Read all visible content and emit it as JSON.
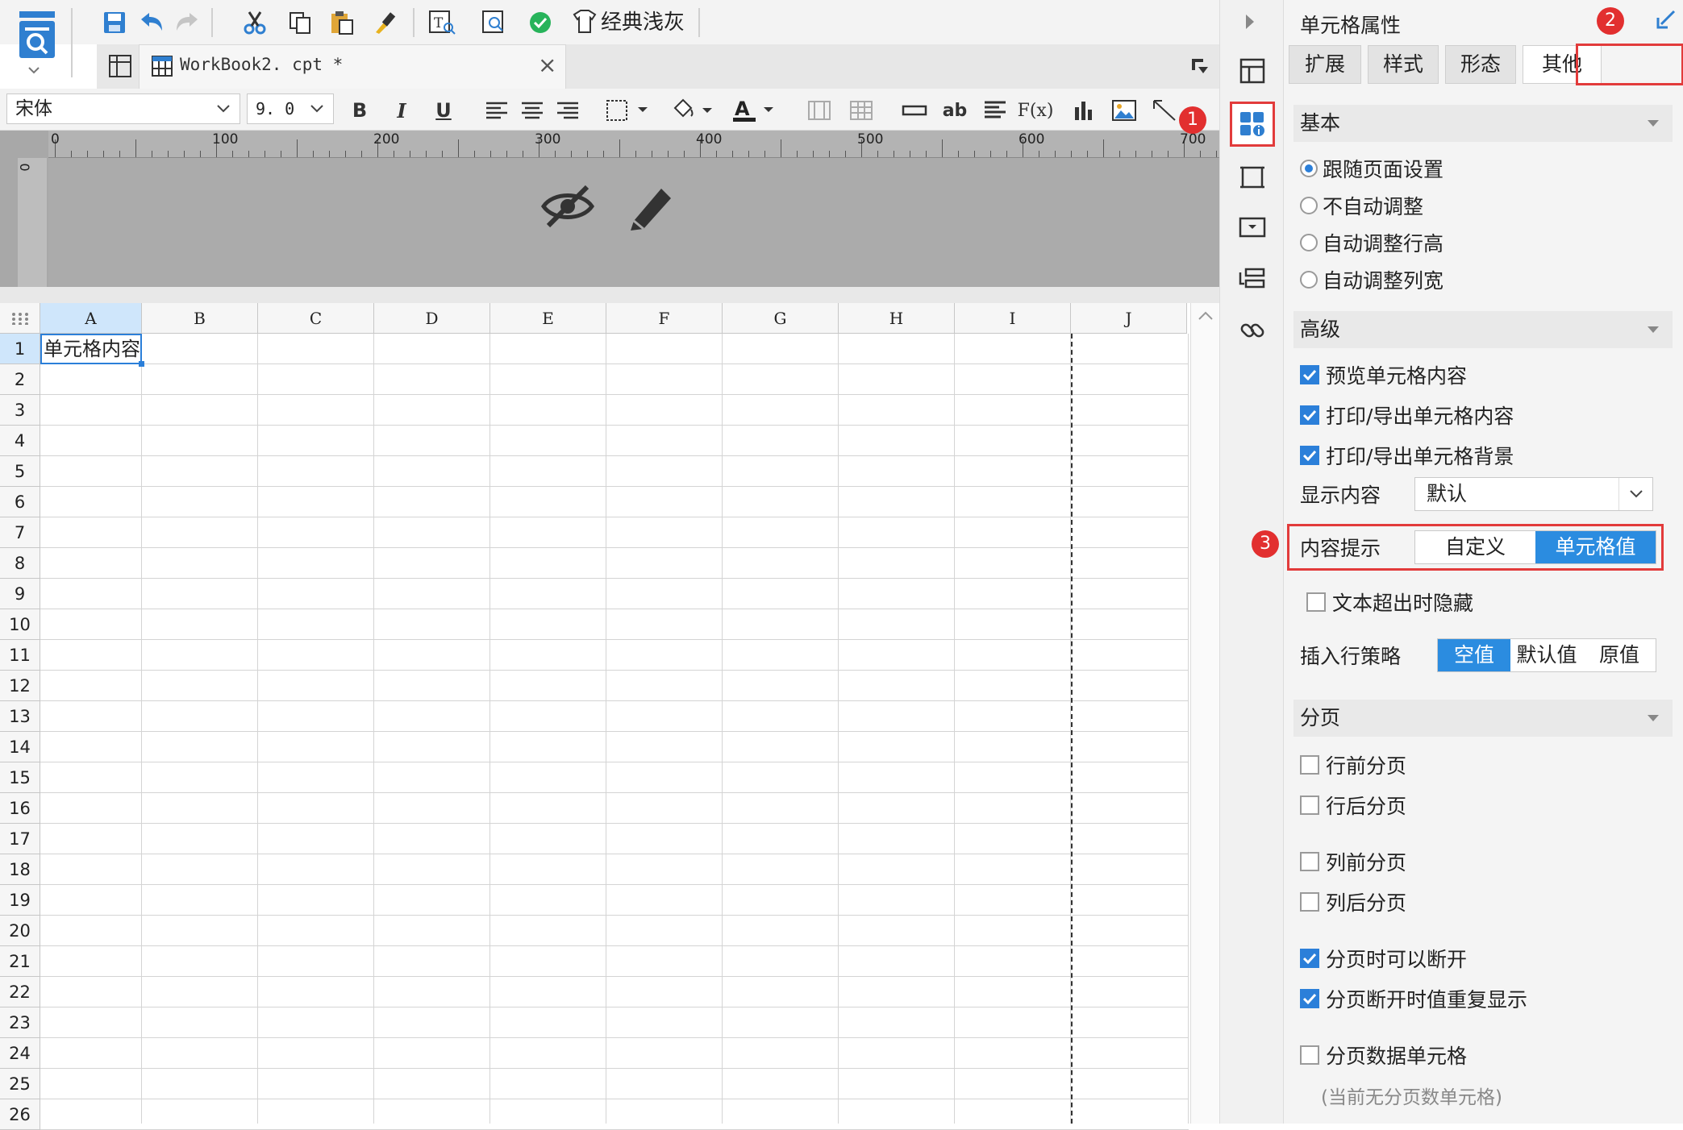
{
  "colors": {
    "accent": "#2b8ce0",
    "highlight_red": "#e22f2f",
    "ok_green": "#27b35a"
  },
  "toolbar": {
    "icons": [
      "save-icon",
      "undo-icon",
      "redo-icon",
      "cut-icon",
      "copy-icon",
      "paste-icon",
      "format-painter-icon",
      "text-preview-icon",
      "cell-search-icon",
      "check-icon"
    ],
    "theme_label": "经典浅灰"
  },
  "tab": {
    "title": "WorkBook2. cpt *",
    "close": "×"
  },
  "format": {
    "font": "宋体",
    "size": "9. 0",
    "bold": "B",
    "italic": "I",
    "underline": "U",
    "text_ab": "ab",
    "formula": "F(x)"
  },
  "ruler": {
    "labels": [
      "0",
      "100",
      "200",
      "300",
      "400",
      "500",
      "600",
      "700"
    ],
    "vertical_label": "0"
  },
  "grid": {
    "columns": [
      "A",
      "B",
      "C",
      "D",
      "E",
      "F",
      "G",
      "H",
      "I",
      "J"
    ],
    "rows": [
      "1",
      "2",
      "3",
      "4",
      "5",
      "6",
      "7",
      "8",
      "9",
      "10",
      "11",
      "12",
      "13",
      "14",
      "15",
      "16",
      "17",
      "18",
      "19",
      "20",
      "21",
      "22",
      "23",
      "24",
      "25",
      "26"
    ],
    "cell_a1": "单元格内容"
  },
  "panel": {
    "title": "单元格属性",
    "tabs": [
      "扩展",
      "样式",
      "形态",
      "其他"
    ],
    "active_tab": "其他",
    "basic": {
      "title": "基本",
      "options": [
        "跟随页面设置",
        "不自动调整",
        "自动调整行高",
        "自动调整列宽"
      ],
      "selected": "跟随页面设置"
    },
    "advanced": {
      "title": "高级",
      "checks": [
        {
          "label": "预览单元格内容",
          "checked": true
        },
        {
          "label": "打印/导出单元格内容",
          "checked": true
        },
        {
          "label": "打印/导出单元格背景",
          "checked": true
        }
      ],
      "display_label": "显示内容",
      "display_value": "默认",
      "tooltip_label": "内容提示",
      "tooltip_options": [
        "自定义",
        "单元格值"
      ],
      "tooltip_selected": "单元格值",
      "hide_overflow": {
        "label": "文本超出时隐藏",
        "checked": false
      },
      "insert_label": "插入行策略",
      "insert_options": [
        "空值",
        "默认值",
        "原值"
      ],
      "insert_selected": "空值"
    },
    "paging": {
      "title": "分页",
      "checks": [
        {
          "label": "行前分页",
          "checked": false
        },
        {
          "label": "行后分页",
          "checked": false
        },
        {
          "label": "列前分页",
          "checked": false
        },
        {
          "label": "列后分页",
          "checked": false
        },
        {
          "label": "分页时可以断开",
          "checked": true
        },
        {
          "label": "分页断开时值重复显示",
          "checked": true
        },
        {
          "label": "分页数据单元格",
          "checked": false
        }
      ],
      "note": "(当前无分页数单元格)"
    }
  },
  "badges": [
    "1",
    "2",
    "3"
  ]
}
